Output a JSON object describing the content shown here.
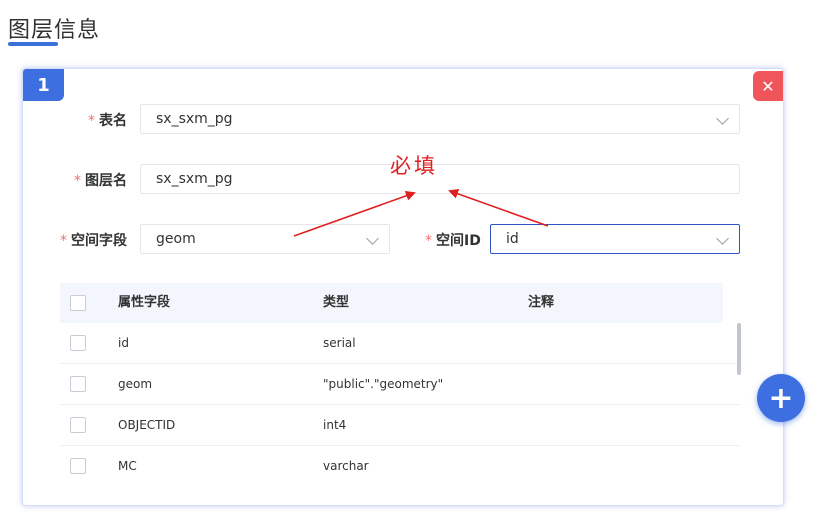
{
  "page": {
    "title": "图层信息"
  },
  "card": {
    "index": "1",
    "close_glyph": "✕",
    "form": {
      "required_mark": "*",
      "table_name": {
        "label": "表名",
        "value": "sx_sxm_pg"
      },
      "layer_name": {
        "label": "图层名",
        "value": "sx_sxm_pg"
      },
      "spatial_field": {
        "label": "空间字段",
        "value": "geom"
      },
      "spatial_id": {
        "label": "空间ID",
        "value": "id"
      }
    },
    "annotation": "必填",
    "table": {
      "headers": [
        "属性字段",
        "类型",
        "注释"
      ],
      "rows": [
        {
          "field": "id",
          "type": "serial",
          "comment": ""
        },
        {
          "field": "geom",
          "type": "\"public\".\"geometry\"",
          "comment": ""
        },
        {
          "field": "OBJECTID",
          "type": "int4",
          "comment": ""
        },
        {
          "field": "MC",
          "type": "varchar",
          "comment": ""
        }
      ]
    }
  },
  "fab": {
    "glyph": "+"
  },
  "colors": {
    "accent": "#3d6fe0",
    "danger": "#f0555b",
    "annotation": "#e02020"
  }
}
